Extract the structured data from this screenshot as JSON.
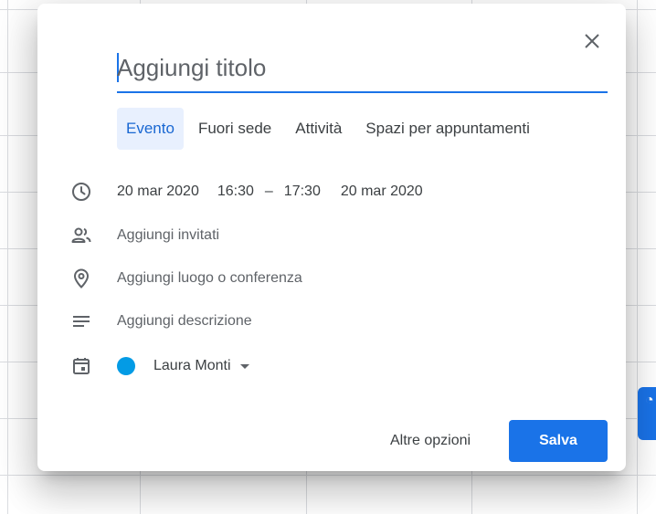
{
  "dialog": {
    "title_placeholder": "Aggiungi titolo",
    "close_label": "×"
  },
  "tabs": [
    {
      "label": "Evento",
      "active": true
    },
    {
      "label": "Fuori sede",
      "active": false
    },
    {
      "label": "Attività",
      "active": false
    },
    {
      "label": "Spazi per appuntamenti",
      "active": false
    }
  ],
  "datetime": {
    "start_date": "20 mar 2020",
    "start_time": "16:30",
    "separator": "–",
    "end_time": "17:30",
    "end_date": "20 mar 2020"
  },
  "guests": {
    "placeholder": "Aggiungi invitati"
  },
  "location": {
    "placeholder": "Aggiungi luogo o conferenza"
  },
  "description": {
    "placeholder": "Aggiungi descrizione"
  },
  "calendar": {
    "owner": "Laura Monti",
    "color": "#039be5"
  },
  "footer": {
    "more_options_label": "Altre opzioni",
    "save_label": "Salva"
  },
  "colors": {
    "accent": "#1a73e8",
    "tab_active_bg": "#e8f0fe"
  },
  "icons": [
    "close-icon",
    "clock-icon",
    "people-icon",
    "location-pin-icon",
    "notes-icon",
    "calendar-icon",
    "dropdown-arrow-icon"
  ]
}
